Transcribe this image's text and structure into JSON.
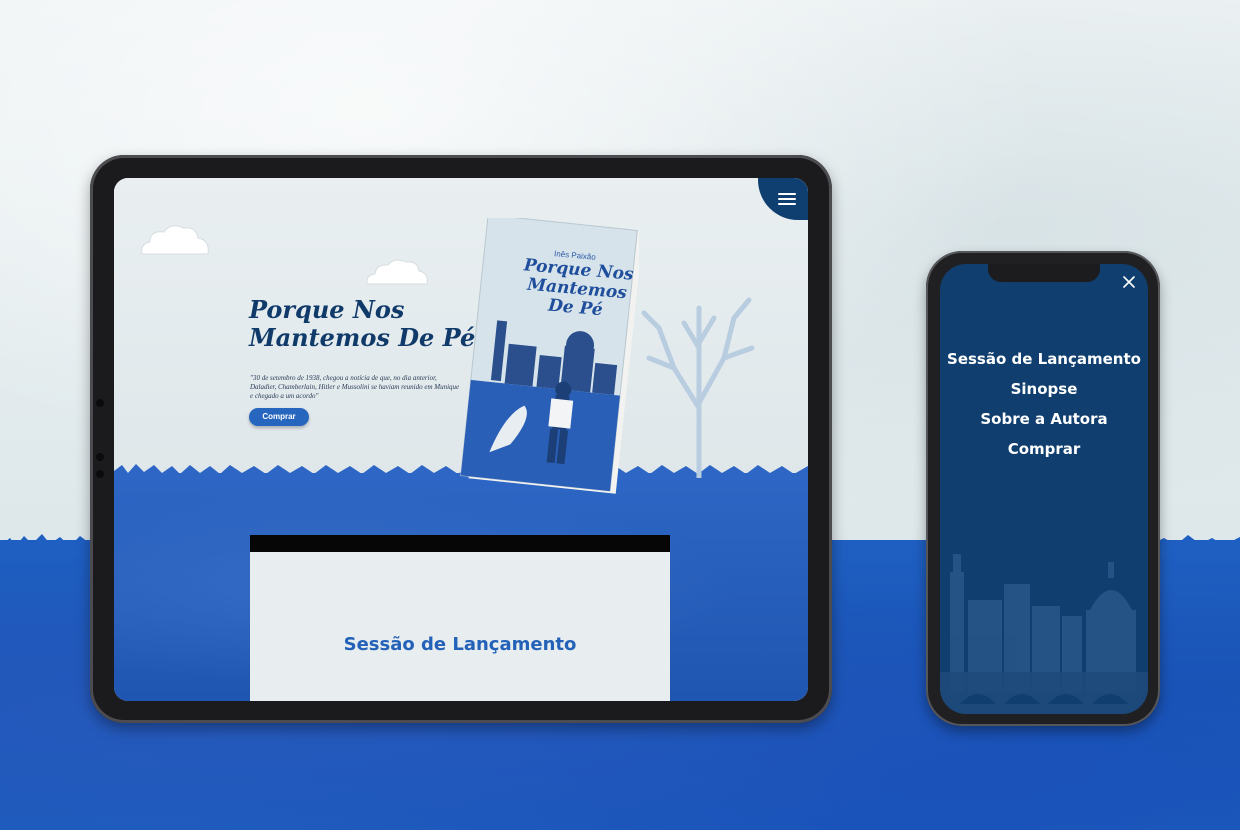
{
  "tablet": {
    "hero_title_line1": "Porque Nos",
    "hero_title_line2": "Mantemos De Pé",
    "hero_quote": "\"30 de setembro de 1938, chegou a notícia de que, no dia anterior, Daladier, Chamberlain, Hitler e Mussolini se haviam reunido em Munique e chegado a um acordo\"",
    "buy_button": "Comprar",
    "book_author": "Inês Paixão",
    "book_title": "Porque Nos Mantemos De Pé",
    "section_title": "Sessão de Lançamento",
    "menu_icon": "hamburger-icon"
  },
  "phone": {
    "close_icon": "close-icon",
    "menu_items": [
      {
        "label": "Sessão de Lançamento"
      },
      {
        "label": "Sinopse"
      },
      {
        "label": "Sobre a Autora"
      },
      {
        "label": "Comprar"
      }
    ]
  },
  "colors": {
    "navy": "#0f3e71",
    "accent_blue": "#2766bf",
    "water_blue": "#1f5fc2"
  }
}
